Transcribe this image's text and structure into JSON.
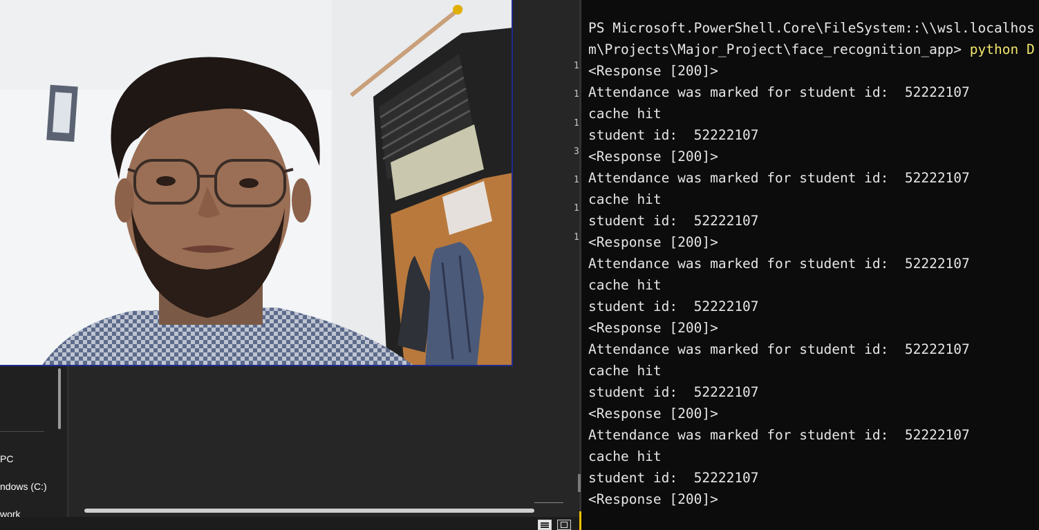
{
  "explorer": {
    "nav_items": [
      {
        "label": "PC"
      },
      {
        "label": "ndows (C:)"
      },
      {
        "label": "work"
      }
    ]
  },
  "editor": {
    "gutter_numbers": [
      "1",
      "1",
      "1",
      "3",
      "1",
      "1",
      "1"
    ]
  },
  "camera_feed": {
    "description_icon": "webcam-icon"
  },
  "terminal": {
    "prompt_line_1": "PS Microsoft.PowerShell.Core\\FileSystem::\\\\wsl.localhos",
    "prompt_line_2_path": "m\\Projects\\Major_Project\\face_recognition_app> ",
    "prompt_line_2_cmd": "python D",
    "output": [
      "<Response [200]>",
      "Attendance was marked for student id:  52222107",
      "cache hit",
      "student id:  52222107",
      "<Response [200]>",
      "Attendance was marked for student id:  52222107",
      "cache hit",
      "student id:  52222107",
      "<Response [200]>",
      "Attendance was marked for student id:  52222107",
      "cache hit",
      "student id:  52222107",
      "<Response [200]>",
      "Attendance was marked for student id:  52222107",
      "cache hit",
      "student id:  52222107",
      "<Response [200]>",
      "Attendance was marked for student id:  52222107",
      "cache hit",
      "student id:  52222107",
      "<Response [200]>"
    ]
  },
  "colors": {
    "terminal_bg": "#0c0c0c",
    "terminal_text": "#e6e6e6",
    "command_text": "#f2e66d",
    "camera_border": "#1f2a8f",
    "accent": "#f0c000"
  }
}
